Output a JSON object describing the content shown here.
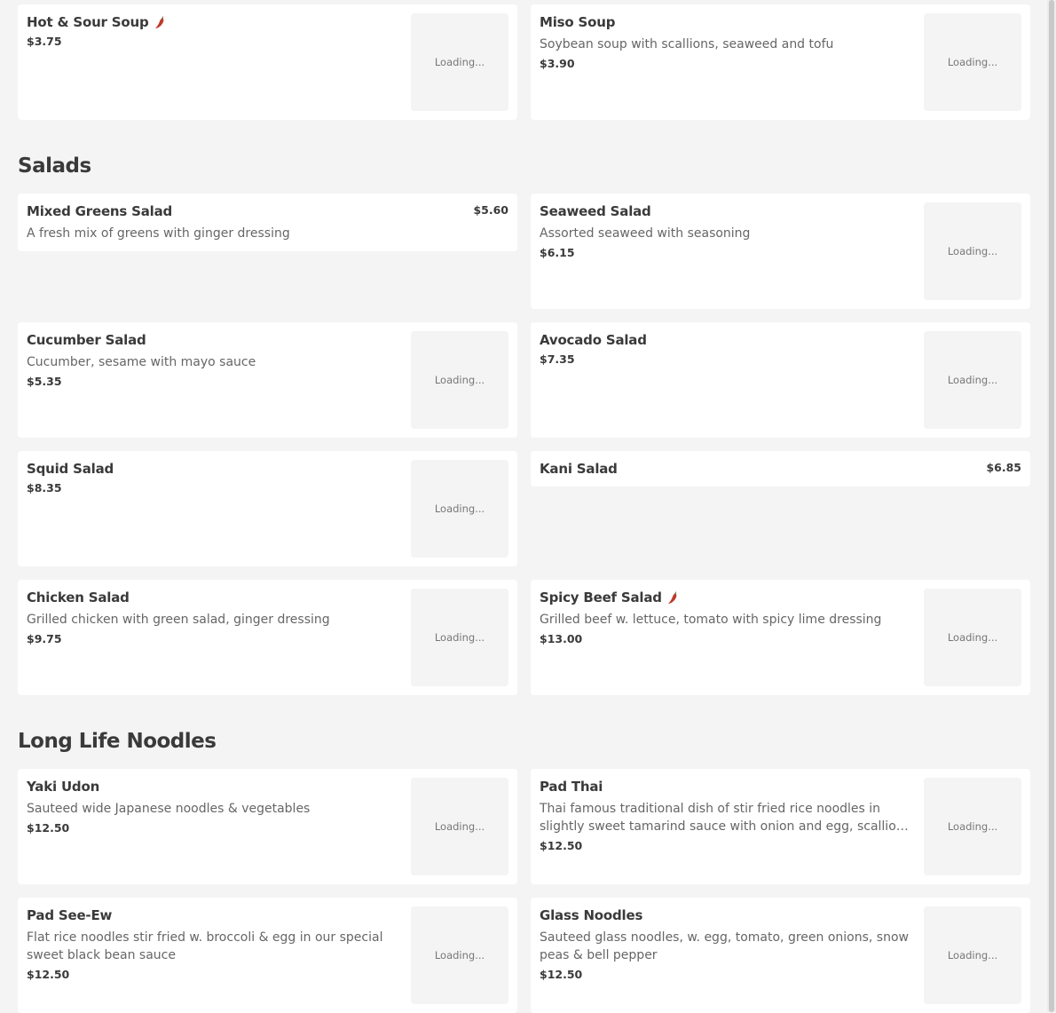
{
  "accent_color": "#c0392b",
  "loading_label": "Loading...",
  "sections": [
    {
      "title": "",
      "items": [
        {
          "name": "Hot & Sour Soup",
          "spicy": true,
          "desc": "",
          "price": "$3.75",
          "image": true
        },
        {
          "name": "Miso Soup",
          "spicy": false,
          "desc": "Soybean soup with scallions, seaweed and tofu",
          "price": "$3.90",
          "image": true
        }
      ]
    },
    {
      "title": "Salads",
      "items": [
        {
          "name": "Mixed Greens Salad",
          "spicy": false,
          "desc": "A fresh mix of greens with ginger dressing",
          "price": "$5.60",
          "image": false
        },
        {
          "name": "Seaweed Salad",
          "spicy": false,
          "desc": "Assorted seaweed with seasoning",
          "price": "$6.15",
          "image": true
        },
        {
          "name": "Cucumber Salad",
          "spicy": false,
          "desc": "Cucumber, sesame with mayo sauce",
          "price": "$5.35",
          "image": true
        },
        {
          "name": "Avocado Salad",
          "spicy": false,
          "desc": "",
          "price": "$7.35",
          "image": true
        },
        {
          "name": "Squid Salad",
          "spicy": false,
          "desc": "",
          "price": "$8.35",
          "image": true
        },
        {
          "name": "Kani Salad",
          "spicy": false,
          "desc": "",
          "price": "$6.85",
          "image": false
        },
        {
          "name": "Chicken Salad",
          "spicy": false,
          "desc": "Grilled chicken with green salad, ginger dressing",
          "price": "$9.75",
          "image": true
        },
        {
          "name": "Spicy Beef Salad",
          "spicy": true,
          "desc": "Grilled beef w. lettuce, tomato with spicy lime dressing",
          "price": "$13.00",
          "image": true
        }
      ]
    },
    {
      "title": "Long Life Noodles",
      "items": [
        {
          "name": "Yaki Udon",
          "spicy": false,
          "desc": "Sauteed wide Japanese noodles & vegetables",
          "price": "$12.50",
          "image": true
        },
        {
          "name": "Pad Thai",
          "spicy": false,
          "desc": "Thai famous traditional dish of stir fried rice noodles in slightly sweet tamarind sauce with onion and egg, scallion, bean sprouts & crushed peanuts",
          "price": "$12.50",
          "image": true
        },
        {
          "name": "Pad See-Ew",
          "spicy": false,
          "desc": "Flat rice noodles stir fried w. broccoli & egg in our special sweet black bean sauce",
          "price": "$12.50",
          "image": true
        },
        {
          "name": "Glass Noodles",
          "spicy": false,
          "desc": "Sauteed glass noodles, w. egg, tomato, green onions, snow peas & bell pepper",
          "price": "$12.50",
          "image": true
        }
      ]
    }
  ]
}
